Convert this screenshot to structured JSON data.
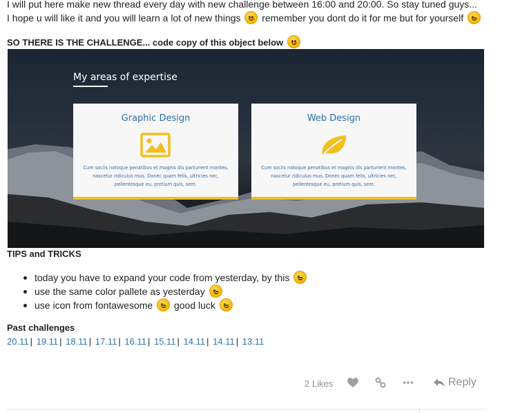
{
  "intro": {
    "line1": "I will put here make new thread every day with new challenge between 16:00 and 20:00. So stay tuned guys...",
    "line2_a": "I hope u will like it and you will learn a lot of new things",
    "line2_b": "remember you dont do it for me but for yourself"
  },
  "challenge_heading": "SO THERE IS THE CHALLENGE... code copy of this object below",
  "banner": {
    "title": "My areas of expertise",
    "cards": [
      {
        "title": "Graphic Design",
        "icon": "image-icon",
        "text": "Cum sociis natoque penatibus et magnis dis parturient montes, nascetur ridiculus mus. Donec quam felis, ultricies nec, pellentesque eu, pretium quis, sem."
      },
      {
        "title": "Web Design",
        "icon": "leaf-icon",
        "text": "Cum sociis natoque penatibus et magnis dis parturient montes, nascetur ridiculus mus. Donec quam felis, ultricies nec, pellentesque eu, pretium quis, sem."
      }
    ],
    "accent_color": "#f2bf1e",
    "title_color": "#2d6da3"
  },
  "tips_heading": "TIPS and TRICKS",
  "tips": {
    "item1": "today you have to expand your code from yesterday, by this",
    "item2": "use the same color pallete as yesterday",
    "item3_a": "use icon from fontawesome",
    "item3_b": "good luck"
  },
  "past_heading": "Past challenges",
  "past_links": [
    "20.11",
    "19.11",
    "18.11",
    "17.11",
    "16.11",
    "15.11",
    "14.11",
    "14.11",
    "13.11"
  ],
  "link_separator": "|",
  "footer": {
    "likes": "2 Likes",
    "reply": "Reply"
  },
  "link_color": "#2a74b7"
}
